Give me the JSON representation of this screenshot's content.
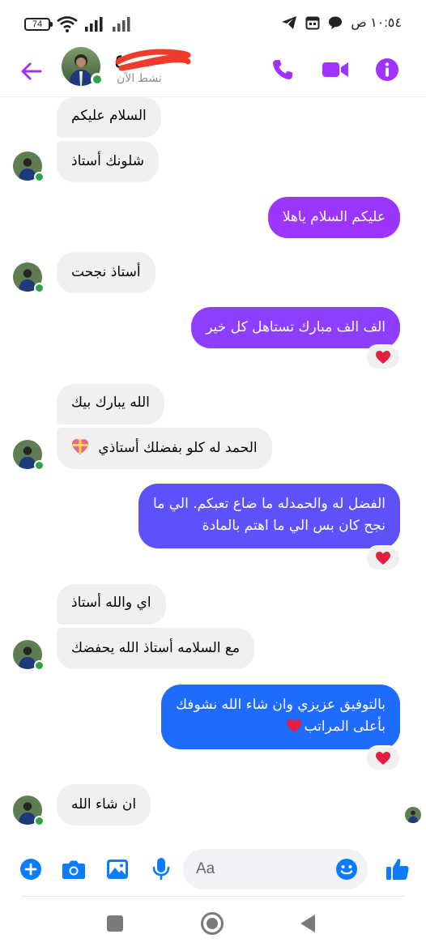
{
  "status_bar": {
    "battery": "74",
    "time": "١٠:٥٤ ص"
  },
  "header": {
    "contact_name": "ع",
    "status": "نشط الآن",
    "icons": [
      "back-arrow-icon",
      "phone-icon",
      "video-camera-icon",
      "info-icon"
    ]
  },
  "colors": {
    "accent": "#a033ff",
    "incoming_bubble": "#f0f0f0",
    "online": "#31a24c",
    "reaction_heart": "#e41e3f",
    "outgoing_gradient": [
      "#a033ff",
      "#7646ff",
      "#4e58f5",
      "#1c6bff"
    ]
  },
  "messages": [
    {
      "side": "in",
      "text": "السلام عليكم"
    },
    {
      "side": "in",
      "text": "شلونك أستاذ"
    },
    {
      "side": "out",
      "text": "عليكم السلام ياهلا"
    },
    {
      "side": "in",
      "text": "أستاذ نجحت"
    },
    {
      "side": "out",
      "text": "الف الف مبارك تستاهل كل خير",
      "reaction": "heart"
    },
    {
      "side": "in",
      "text": "الله يبارك بيك"
    },
    {
      "side": "in",
      "text": "الحمد له كلو بفضلك أستاذي",
      "emoji": "heart-gift-icon"
    },
    {
      "side": "out",
      "lines": [
        "الفضل له والحمدله ما ضاع تعبكم. الي ما",
        "نجح كان بس الي ما اهتم بالمادة"
      ],
      "reaction": "heart"
    },
    {
      "side": "in",
      "text": "اي والله أستاذ"
    },
    {
      "side": "in",
      "text": "مع السلامه أستاذ الله يحفضك"
    },
    {
      "side": "out",
      "lines": [
        "بالتوفيق عزيزي وان شاء الله نشوفك",
        "بأعلى المراتب"
      ],
      "emoji": "red-heart-icon",
      "reaction": "heart"
    },
    {
      "side": "in",
      "text": "ان شاء الله"
    }
  ],
  "composer": {
    "placeholder": "Aa",
    "icons": [
      "plus-icon",
      "camera-icon",
      "gallery-icon",
      "microphone-icon",
      "emoji-icon",
      "like-icon"
    ]
  },
  "nav": {
    "icons": [
      "recents-icon",
      "home-icon",
      "back-icon"
    ]
  }
}
